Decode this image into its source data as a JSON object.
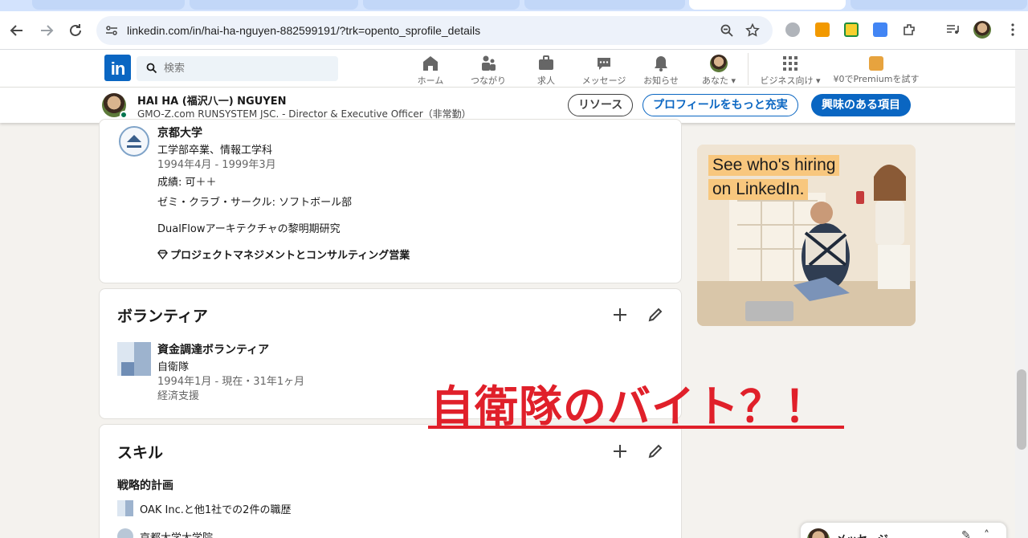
{
  "browser": {
    "url": "linkedin.com/in/hai-ha-nguyen-882599191/?trk=opento_sprofile_details"
  },
  "linkedin_nav": {
    "logo_text": "in",
    "search_placeholder": "検索",
    "items": [
      {
        "label": "ホーム",
        "icon": "home-icon"
      },
      {
        "label": "つながり",
        "icon": "network-icon"
      },
      {
        "label": "求人",
        "icon": "jobs-icon"
      },
      {
        "label": "メッセージ",
        "icon": "messaging-icon"
      },
      {
        "label": "お知らせ",
        "icon": "bell-icon"
      },
      {
        "label": "あなた",
        "icon": "avatar"
      },
      {
        "label": "ビジネス向け",
        "icon": "grid-icon"
      },
      {
        "label": "¥0でPremiumを試す",
        "icon": "premium-icon"
      }
    ]
  },
  "profile_bar": {
    "name": "HAI HA (福沢八一) NGUYEN",
    "headline": "GMO-Z.com RUNSYSTEM JSC. - Director & Executive Officer（非常勤）",
    "buttons": {
      "resources": "リソース",
      "enhance": "プロフィールをもっと充実",
      "interested": "興味のある項目"
    }
  },
  "education": {
    "school": "京都大学",
    "degree": "工学部卒業、情報工学科",
    "dates": "1994年4月 - 1999年3月",
    "grade": "成績: 可＋＋",
    "activities": "ゼミ・クラブ・サークル: ソフトボール部",
    "description": "DualFlowアーキテクチャの黎明期研究",
    "skill": "プロジェクトマネジメントとコンサルティング営業"
  },
  "volunteer": {
    "title": "ボランティア",
    "role": "資金調達ボランティア",
    "org": "自衛隊",
    "dates": "1994年1月 - 現在・31年1ヶ月",
    "cause": "経済支援"
  },
  "skills": {
    "title": "スキル",
    "skill_name": "戦略的計画",
    "endorsements": [
      "OAK Inc.と他1社での2件の職歴",
      "京都大学大学院"
    ]
  },
  "ad": {
    "headline_line1": "See who's hiring",
    "headline_line2": "on LinkedIn."
  },
  "overlay_caption": "自衛隊のバイト？！",
  "messaging": {
    "label": "メッセージ"
  },
  "colors": {
    "linkedin_blue": "#0a66c2",
    "overlay_red": "#e0202a",
    "page_bg": "#f4f2ee"
  }
}
